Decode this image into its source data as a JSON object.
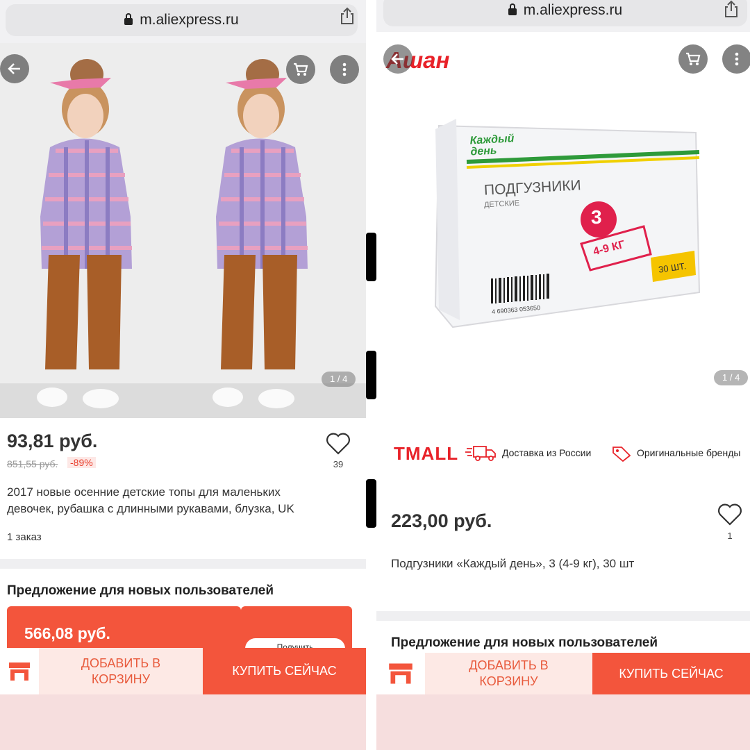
{
  "left": {
    "url": "m.aliexpress.ru",
    "image_counter": "1 / 4",
    "price": "93,81 руб.",
    "old_price": "851,55 руб.",
    "discount": "-89%",
    "likes": "39",
    "title_line1": "2017 новые осенние детские топы для маленьких",
    "title_line2": "девочек, рубашка с длинными рукавами, блузка, UK",
    "orders": "1 заказ",
    "offer_heading": "Предложение для новых пользователей",
    "coupon_price": "566,08 руб.",
    "coupon_button": "Получить",
    "add_to_cart_line1": "ДОБАВИТЬ В",
    "add_to_cart_line2": "КОРЗИНУ",
    "buy_now": "КУПИТЬ СЕЙЧАС"
  },
  "right": {
    "url": "m.aliexpress.ru",
    "store_logo": "Ашан",
    "image_counter": "1 / 4",
    "tmall": "TMALL",
    "delivery_badge": "Доставка из России",
    "brands_badge": "Оригинальные бренды",
    "price": "223,00 руб.",
    "likes": "1",
    "title": "Подгузники «Каждый день», 3 (4-9 кг), 30 шт",
    "offer_heading": "Предложение для новых пользователей",
    "add_to_cart_line1": "ДОБАВИТЬ В",
    "add_to_cart_line2": "КОРЗИНУ",
    "buy_now": "КУПИТЬ СЕЙЧАС",
    "package": {
      "brand": "Каждый день",
      "product": "ПОДГУЗНИКИ",
      "subtitle": "ДЕТСКИЕ",
      "size": "3",
      "weight": "4-9 КГ",
      "count": "30 ШТ.",
      "barcode": "4 690363 053650"
    }
  },
  "colors": {
    "accent": "#f3553c",
    "tmall_red": "#e82229",
    "page_bg": "#f6dede"
  }
}
